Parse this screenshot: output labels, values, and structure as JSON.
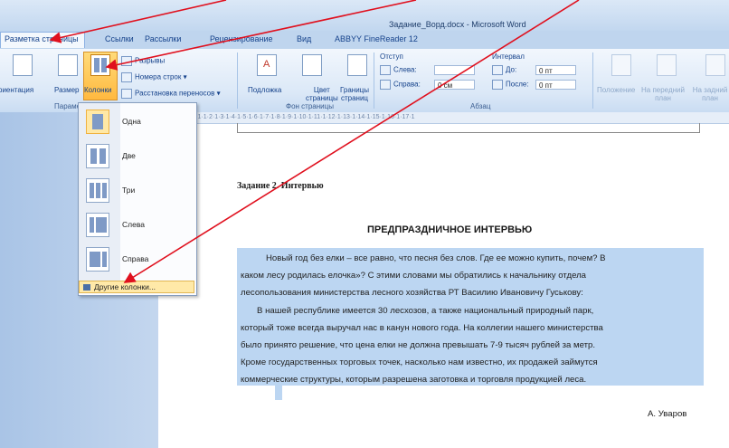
{
  "window": {
    "title": "Задание_Ворд.docx - Microsoft Word"
  },
  "tabs": [
    {
      "label": "Разметка страницы",
      "active": true
    },
    {
      "label": "Ссылки"
    },
    {
      "label": "Рассылки"
    },
    {
      "label": "Рецензирование"
    },
    {
      "label": "Вид"
    },
    {
      "label": "ABBYY FineReader 12"
    }
  ],
  "ribbon": {
    "page_setup": {
      "orientation": "риентация",
      "size": "Размер",
      "columns": "Колонки",
      "breaks": "Разрывы",
      "line_numbers": "Номера строк",
      "hyphenation": "Расстановка переносов",
      "group_label": "Парамет"
    },
    "background": {
      "watermark": "Подложка",
      "page_color_1": "Цвет",
      "page_color_2": "страницы",
      "borders_1": "Границы",
      "borders_2": "страниц",
      "group_label": "Фон страницы"
    },
    "paragraph": {
      "indent_label": "Отступ",
      "left_label": "Слева:",
      "left_value": "",
      "right_label": "Справа:",
      "right_value": "0 см",
      "spacing_label": "Интервал",
      "before_label": "До:",
      "before_value": "0 пт",
      "after_label": "После:",
      "after_value": "0 пт",
      "group_label": "Абзац"
    },
    "arrange": {
      "position": "Положение",
      "bring_front": "На передний план",
      "send_back": "На задний план"
    }
  },
  "ruler": {
    "text": "·1·1·1·2·1·3·1·4·1·5·1·6·1·7·1·8·1·9·1·10·1·11·1·12·1·13·1·14·1·15·1·16·1·17·1"
  },
  "columns_menu": {
    "items": [
      "Одна",
      "Две",
      "Три",
      "Слева",
      "Справа"
    ],
    "more": "Другие колонки..."
  },
  "document": {
    "task_heading": "Задание 2. Интервью",
    "title": "ПРЕДПРАЗДНИЧНОЕ ИНТЕРВЬЮ",
    "lines": [
      "Новый год без елки – все равно, что песня без слов. Где ее можно купить, почем? В",
      "каком лесу родилась елочка»? С этими словами мы обратились к начальнику отдела",
      "лесопользования министерства лесного хозяйства РТ Василию Ивановичу Гуськову:",
      "В нашей республике имеется 30 лесхозов, а также национальный природный парк,",
      "который тоже всегда выручал нас в канун нового года. На коллегии нашего министерства",
      "было принято решение, что цена елки не должна превышать 7-9 тысяч рублей за метр.",
      "Кроме государственных торговых точек, насколько нам известно, их продажей займутся",
      "коммерческие структуры, которым разрешена заготовка и торговля продукцией леса."
    ],
    "author": "А. Уваров"
  },
  "colors": {
    "arrow": "#e0101e",
    "selection": "#bcd6f2",
    "ribbon": "#dbe8f7"
  }
}
